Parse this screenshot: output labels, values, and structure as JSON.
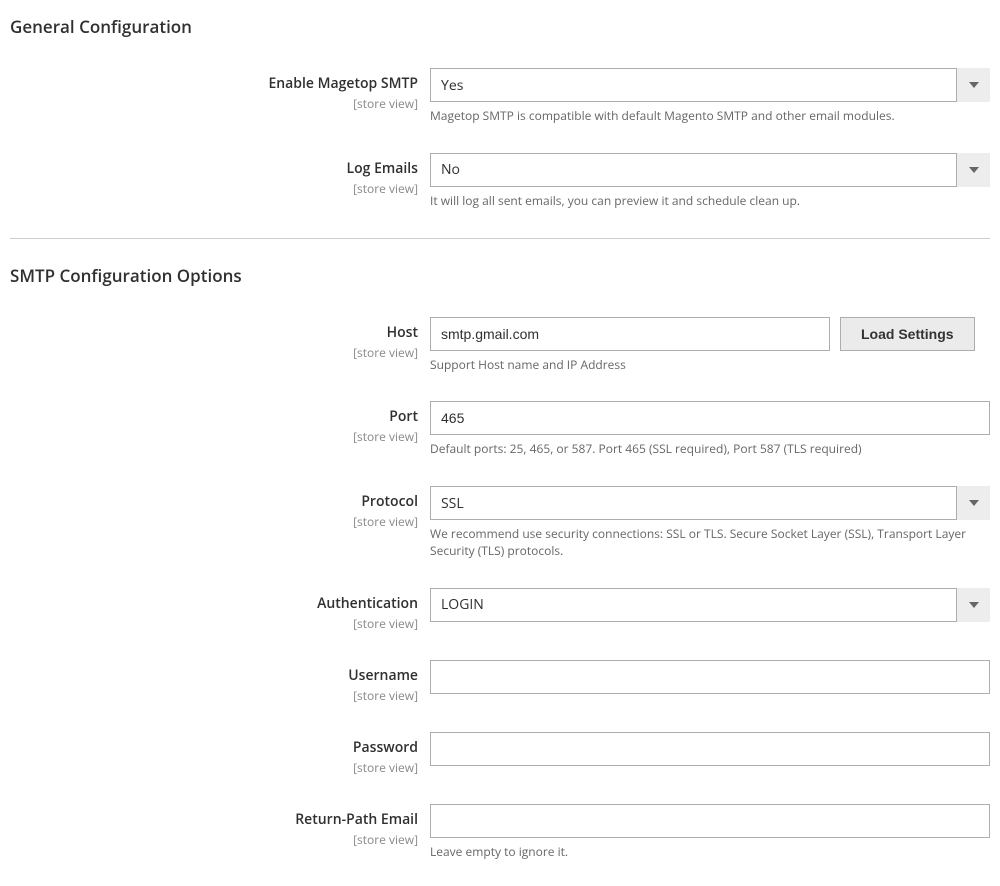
{
  "scope_label": "[store view]",
  "general": {
    "title": "General Configuration",
    "enable": {
      "label": "Enable Magetop SMTP",
      "value": "Yes",
      "note": "Magetop SMTP is compatible with default Magento SMTP and other email modules."
    },
    "log": {
      "label": "Log Emails",
      "value": "No",
      "note": "It will log all sent emails, you can preview it and schedule clean up."
    }
  },
  "smtp": {
    "title": "SMTP Configuration Options",
    "host": {
      "label": "Host",
      "value": "smtp.gmail.com",
      "note": "Support Host name and IP Address",
      "load_btn": "Load Settings"
    },
    "port": {
      "label": "Port",
      "value": "465",
      "note": "Default ports: 25, 465, or 587. Port 465 (SSL required), Port 587 (TLS required)"
    },
    "protocol": {
      "label": "Protocol",
      "value": "SSL",
      "note": "We recommend use security connections: SSL or TLS. Secure Socket Layer (SSL), Transport Layer Security (TLS) protocols."
    },
    "auth": {
      "label": "Authentication",
      "value": "LOGIN"
    },
    "username": {
      "label": "Username",
      "value": ""
    },
    "password": {
      "label": "Password",
      "value": ""
    },
    "return_path": {
      "label": "Return-Path Email",
      "value": "",
      "note": "Leave empty to ignore it."
    }
  }
}
